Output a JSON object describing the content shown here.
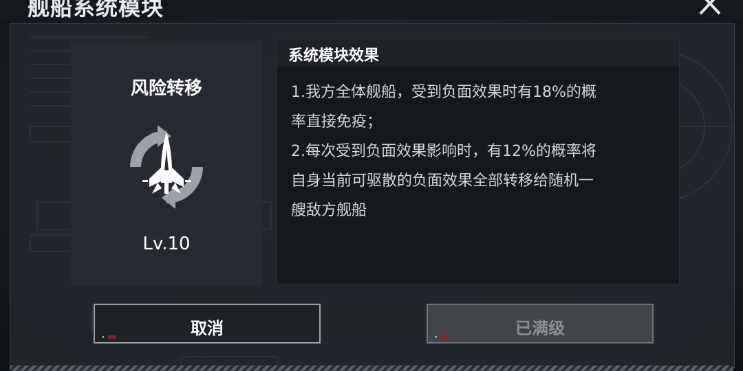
{
  "header": {
    "title": "舰船系统模块"
  },
  "module": {
    "name": "风险转移",
    "level": "Lv.10",
    "icon": "ship-cycle-icon"
  },
  "effect": {
    "title": "系统模块效果",
    "lines": [
      "1.我方全体舰船，受到负面效果时有18%的概",
      "率直接免疫；",
      "2.每次受到负面效果影响时，有12%的概率将",
      "自身当前可驱散的负面效果全部转移给随机一",
      "艘敌方舰船"
    ]
  },
  "buttons": {
    "cancel_label": "取消",
    "maxed_label": "已满级",
    "maxed_disabled": true
  },
  "colors": {
    "accent": "#ffffff",
    "disabled": "#414548",
    "tag_red": "#8b1e24"
  }
}
